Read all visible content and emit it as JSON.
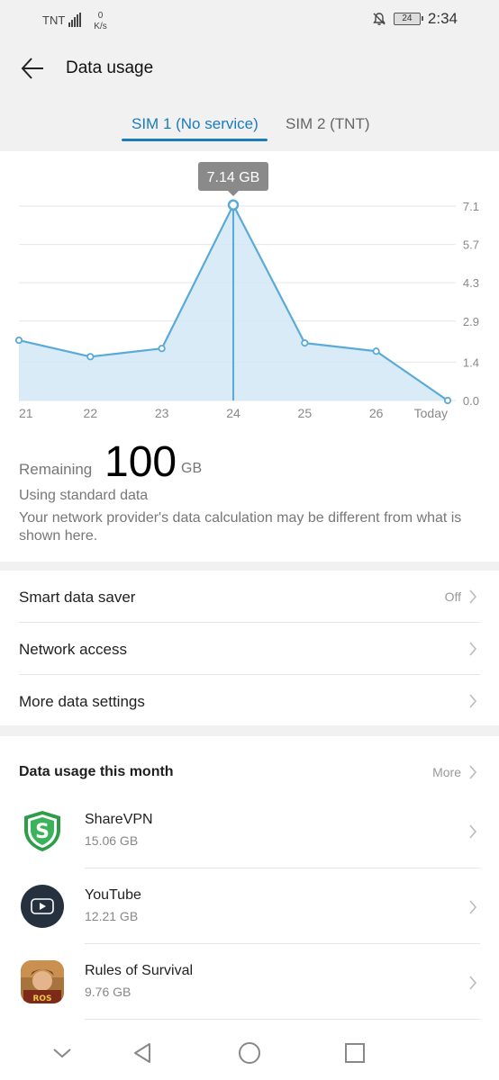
{
  "status_bar": {
    "carrier": "TNT",
    "net_speed_value": "0",
    "net_speed_unit": "K/s",
    "battery": "24",
    "time": "2:34"
  },
  "header": {
    "title": "Data usage"
  },
  "tabs": [
    {
      "label": "SIM 1 (No service)",
      "active": true
    },
    {
      "label": "SIM 2 (TNT)",
      "active": false
    }
  ],
  "chart_data": {
    "type": "area",
    "categories": [
      "21",
      "22",
      "23",
      "24",
      "25",
      "26",
      "Today"
    ],
    "series": [
      {
        "values": [
          2.2,
          1.6,
          1.9,
          7.14,
          2.1,
          1.8,
          0.0
        ]
      }
    ],
    "y_ticks": [
      "7.1",
      "5.7",
      "4.3",
      "2.9",
      "1.4",
      "0.0"
    ],
    "ylim": [
      0,
      7.1
    ],
    "tooltip": "7.14 GB",
    "selected_index": 3,
    "line_color": "#5aaad8",
    "fill_color": "#d4e7f7",
    "grid": true
  },
  "remaining": {
    "label": "Remaining",
    "value": "100",
    "unit": "GB"
  },
  "standard_data": "Using standard data",
  "disclaimer": "Your network provider's data calculation may be different from what is shown here.",
  "settings": {
    "smart_saver": {
      "label": "Smart data saver",
      "value": "Off"
    },
    "network_access": {
      "label": "Network access"
    },
    "more_settings": {
      "label": "More data settings"
    }
  },
  "apps_section": {
    "title": "Data usage this month",
    "more": "More",
    "apps": [
      {
        "name": "ShareVPN",
        "size": "15.06 GB",
        "icon": "sharevpn-icon"
      },
      {
        "name": "YouTube",
        "size": "12.21 GB",
        "icon": "youtube-icon"
      },
      {
        "name": "Rules of Survival",
        "size": "9.76 GB",
        "icon": "rules-of-survival-icon"
      }
    ]
  },
  "colors": {
    "accent": "#1b7bbd",
    "background": "#f1f1f1"
  }
}
